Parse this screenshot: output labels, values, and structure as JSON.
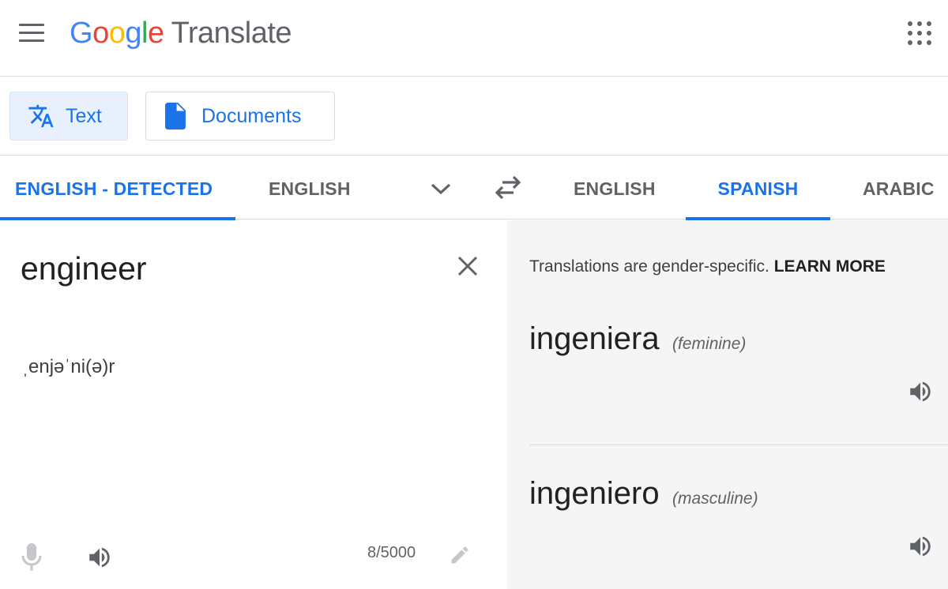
{
  "header": {
    "logo_letters": [
      "G",
      "o",
      "o",
      "g",
      "l",
      "e"
    ],
    "product": "Translate",
    "menu_icon": "hamburger-menu-icon",
    "apps_icon": "apps-grid-icon"
  },
  "modes": {
    "text_label": "Text",
    "documents_label": "Documents",
    "selected": "Text"
  },
  "source_languages": {
    "detected": "ENGLISH - DETECTED",
    "english": "ENGLISH",
    "selected": "ENGLISH - DETECTED"
  },
  "target_languages": {
    "english": "ENGLISH",
    "spanish": "SPANISH",
    "arabic": "ARABIC",
    "selected": "SPANISH"
  },
  "source": {
    "text": "engineer",
    "phonetic": "ˌenjəˈni(ə)r",
    "char_count": "8/5000"
  },
  "target": {
    "notice_text": "Translations are gender-specific.",
    "learn_more": "LEARN MORE",
    "translations": [
      {
        "word": "ingeniera",
        "gender": "(feminine)"
      },
      {
        "word": "ingeniero",
        "gender": "(masculine)"
      }
    ]
  },
  "colors": {
    "accent": "#1a73e8",
    "logo_blue": "#4285f4",
    "logo_red": "#ea4335",
    "logo_yellow": "#fbbc05",
    "logo_green": "#34a853",
    "target_panel_bg": "#f5f5f5"
  }
}
